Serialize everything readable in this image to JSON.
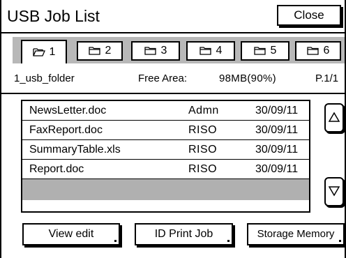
{
  "header": {
    "title": "USB Job List",
    "close_label": "Close"
  },
  "tabs": [
    {
      "label": "1",
      "active": true
    },
    {
      "label": "2",
      "active": false
    },
    {
      "label": "3",
      "active": false
    },
    {
      "label": "4",
      "active": false
    },
    {
      "label": "5",
      "active": false
    },
    {
      "label": "6",
      "active": false
    }
  ],
  "info": {
    "folder": "1_usb_folder",
    "free_area_label": "Free Area:",
    "free_area_value": "98MB(90%)",
    "page": "P.1/1"
  },
  "files": [
    {
      "name": "NewsLetter.doc",
      "owner": "Admn",
      "date": "30/09/11"
    },
    {
      "name": "FaxReport.doc",
      "owner": "RISO",
      "date": "30/09/11"
    },
    {
      "name": "SummaryTable.xls",
      "owner": "RISO",
      "date": "30/09/11"
    },
    {
      "name": "Report.doc",
      "owner": "RISO",
      "date": "30/09/11"
    }
  ],
  "buttons": {
    "view_edit": "View edit",
    "id_print_job": "ID Print Job",
    "storage_memory": "Storage Memory"
  },
  "icons": {
    "tab_active": "open-folder-icon",
    "tab_inactive": "folder-icon",
    "scroll_up": "triangle-up-icon",
    "scroll_down": "triangle-down-icon"
  },
  "colors": {
    "tab_strip": "#b8b8b8",
    "selected_row": "#b0b0b0"
  }
}
